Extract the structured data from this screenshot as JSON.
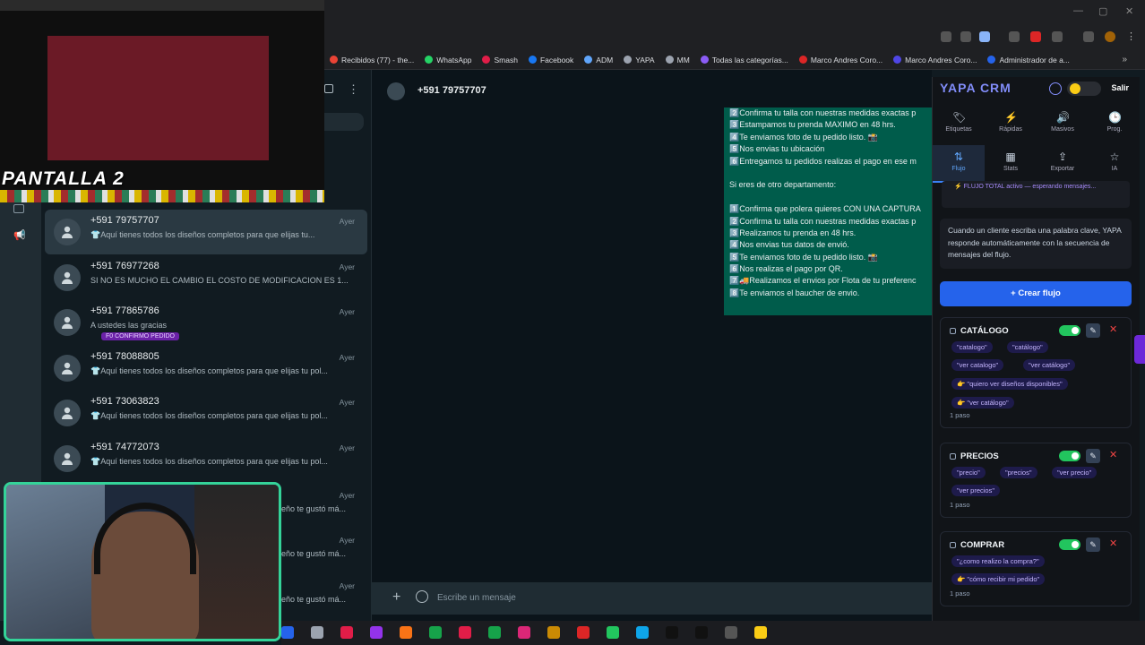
{
  "bookmarks": [
    {
      "label": "Recibidos (77) - the...",
      "color": "#ea4335"
    },
    {
      "label": "WhatsApp",
      "color": "#25d366"
    },
    {
      "label": "Smash",
      "color": "#e11d48"
    },
    {
      "label": "Facebook",
      "color": "#1877f2"
    },
    {
      "label": "ADM",
      "color": "#60a5fa"
    },
    {
      "label": "YAPA",
      "color": "#9ca3af"
    },
    {
      "label": "MM",
      "color": "#9ca3af"
    },
    {
      "label": "Todas las categorías...",
      "color": "#8b5cf6"
    },
    {
      "label": "Marco Andres Coro...",
      "color": "#dc2626"
    },
    {
      "label": "Marco Andres Coro...",
      "color": "#4f46e5"
    },
    {
      "label": "Administrador de a...",
      "color": "#2563eb"
    }
  ],
  "overlay": {
    "scene_label": "PANTALLA 2"
  },
  "chats": [
    {
      "name": "+591 79757707",
      "time": "Ayer",
      "preview": "👕Aquí tienes todos los diseños completos para que elijas tu...",
      "active": true
    },
    {
      "name": "+591 76977268",
      "time": "Ayer",
      "preview": "SI NO ES MUCHO EL CAMBIO EL COSTO DE MODIFICACION ES 1..."
    },
    {
      "name": "+591 77865786",
      "time": "Ayer",
      "preview": "A ustedes las gracias",
      "tag": "F0 CONFIRMO PEDIDO"
    },
    {
      "name": "+591 78088805",
      "time": "Ayer",
      "preview": "👕Aquí tienes todos los diseños completos para que elijas tu pol..."
    },
    {
      "name": "+591 73063823",
      "time": "Ayer",
      "preview": "👕Aquí tienes todos los diseños completos para que elijas tu pol..."
    },
    {
      "name": "+591 74772073",
      "time": "Ayer",
      "preview": "👕Aquí tienes todos los diseños completos para que elijas tu pol..."
    }
  ],
  "partial_previews": [
    {
      "time": "Ayer",
      "text": "eño te gustó má..."
    },
    {
      "time": "Ayer",
      "text": "eño te gustó má..."
    },
    {
      "time": "Ayer",
      "text": "eño te gustó má..."
    }
  ],
  "conversation": {
    "contact": "+591 79757707",
    "lines": [
      "2️⃣Confirma tu talla con nuestras medidas exactas p",
      "3️⃣Estampamos tu prenda MAXIMO en 48 hrs.",
      "4️⃣Te enviamos foto de tu pedido listo. 📸",
      "5️⃣Nos envias tu ubicación",
      "6️⃣Entregamos tu pedidos realizas el pago en ese m",
      "",
      "Si eres de otro departamento:",
      "",
      "1️⃣Confirma que polera quieres CON UNA CAPTURA",
      "2️⃣Confirma tu talla con nuestras medidas exactas p",
      "3️⃣Realizamos tu prenda en 48 hrs.",
      "4️⃣Nos envias tus datos de envió.",
      "5️⃣Te enviamos foto de tu pedido listo. 📸",
      "6️⃣Nos realizas el pago por QR.",
      "7️⃣🚚Realizamos el envios por Flota de tu preferenc",
      "8️⃣Te enviamos el baucher de envio."
    ],
    "composer_placeholder": "Escribe un mensaje"
  },
  "crm": {
    "title": "YAPA CRM",
    "exit_label": "Salir",
    "nav": [
      {
        "label": "Etiquetas",
        "icon": "🏷"
      },
      {
        "label": "Rápidas",
        "icon": "⚡"
      },
      {
        "label": "Masivos",
        "icon": "🔊"
      },
      {
        "label": "Prog.",
        "icon": "🕒"
      },
      {
        "label": "Flujo",
        "icon": "⇅",
        "active": true
      },
      {
        "label": "Stats",
        "icon": "▦"
      },
      {
        "label": "Exportar",
        "icon": "⇪"
      },
      {
        "label": "IA",
        "icon": "☆"
      }
    ],
    "status": "⚡ FLUJO TOTAL activo — esperando mensajes...",
    "info": "Cuando un cliente escriba una palabra clave, YAPA responde automáticamente con la secuencia de mensajes del flujo.",
    "create_label": "+ Crear flujo",
    "flows": [
      {
        "name": "CATÁLOGO",
        "keywords": [
          "\"catalogo\"",
          "\"catálogo\"",
          "\"ver catalogo\"",
          "\"ver catálogo\"",
          "👉 \"quiero ver diseños disponibles\"",
          "👉 \"ver catálogo\""
        ],
        "steps": "1 paso"
      },
      {
        "name": "PRECIOS",
        "keywords": [
          "\"precio\"",
          "\"precios\"",
          "\"ver precio\"",
          "\"ver precios\""
        ],
        "steps": "1 paso"
      },
      {
        "name": "COMPRAR",
        "keywords": [
          "\"¿como realizo la compra?\"",
          "👉 \"cómo recibir mi pedido\""
        ],
        "steps": "1 paso"
      }
    ]
  }
}
